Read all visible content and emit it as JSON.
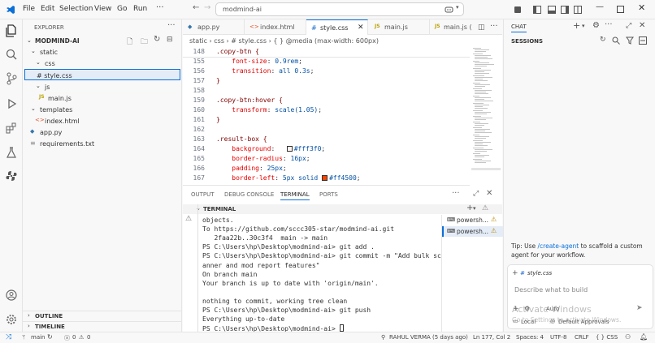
{
  "titlebar": {
    "menus": [
      "File",
      "Edit",
      "Selection",
      "View",
      "Go",
      "Run"
    ],
    "search_text": "modmind-ai",
    "accent": "#0a6fd8"
  },
  "explorer": {
    "header": "EXPLORER",
    "project": "MODMIND-AI",
    "items": [
      {
        "label": "static",
        "icon": "chevron-down-icon"
      },
      {
        "label": "css",
        "icon": "chevron-down-icon"
      },
      {
        "label": "# style.css",
        "icon": "css-file-icon"
      },
      {
        "label": "js",
        "icon": "chevron-down-icon"
      },
      {
        "label": "main.js",
        "icon": "js-file-icon"
      },
      {
        "label": "templates",
        "icon": "chevron-down-icon"
      },
      {
        "label": "index.html",
        "icon": "html-file-icon"
      },
      {
        "label": "app.py",
        "icon": "python-file-icon"
      },
      {
        "label": "requirements.txt",
        "icon": "text-file-icon"
      }
    ],
    "outline": "OUTLINE",
    "timeline": "TIMELINE"
  },
  "tabs": [
    {
      "label": "app.py",
      "icon": "python-file-icon"
    },
    {
      "label": "index.html",
      "icon": "html-file-icon"
    },
    {
      "label": "style.css",
      "icon": "css-file-icon"
    },
    {
      "label": "main.js",
      "icon": "js-file-icon"
    },
    {
      "label": "main.js (",
      "icon": "js-file-icon"
    }
  ],
  "breadcrumb": [
    "static",
    "css",
    "# style.css",
    "{ } @media (max-width: 600px)"
  ],
  "editor": {
    "lines": [
      {
        "n": "148",
        "t": ".copy-btn {"
      },
      {
        "n": "155",
        "t": "    font-size: 0.9rem;"
      },
      {
        "n": "156",
        "t": "    transition: all 0.3s;"
      },
      {
        "n": "157",
        "t": "}"
      },
      {
        "n": "158",
        "t": ""
      },
      {
        "n": "159",
        "t": ".copy-btn:hover {"
      },
      {
        "n": "160",
        "t": "    transform: scale(1.05);"
      },
      {
        "n": "161",
        "t": "}"
      },
      {
        "n": "162",
        "t": ""
      },
      {
        "n": "163",
        "t": ".result-box {"
      },
      {
        "n": "164",
        "t": "    background:   #fff3f0;"
      },
      {
        "n": "165",
        "t": "    border-radius: 16px;"
      },
      {
        "n": "166",
        "t": "    padding: 25px;"
      },
      {
        "n": "167",
        "t": "    border-left: 5px solid   #ff4500;"
      }
    ],
    "swatches": [
      "#fff3f0",
      "#ff4500"
    ]
  },
  "panel": {
    "tabs": [
      "OUTPUT",
      "DEBUG CONSOLE",
      "TERMINAL",
      "PORTS"
    ],
    "terminal_title": "TERMINAL",
    "lines": [
      "objects.",
      "To https://github.com/sccc305-star/modmind-ai.git",
      "   2faa22b..30c3f4  main -> main",
      "PS C:\\Users\\hp\\Desktop\\modmind-ai> git add .",
      "PS C:\\Users\\hp\\Desktop\\modmind-ai> git commit -m \"Add bulk sc",
      "anner and mod report features\"",
      "On branch main",
      "Your branch is up to date with 'origin/main'.",
      "",
      "nothing to commit, working tree clean",
      "PS C:\\Users\\hp\\Desktop\\modmind-ai> git push",
      "Everything up-to-date",
      "PS C:\\Users\\hp\\Desktop\\modmind-ai> "
    ],
    "sessions": [
      "powersh...",
      "powersh..."
    ]
  },
  "chat": {
    "title": "CHAT",
    "sessions_header": "SESSIONS",
    "tip_prefix": "Tip: Use ",
    "tip_link": "/create-agent",
    "tip_suffix": " to scaffold a custom agent for your workflow.",
    "context_file": "style.css",
    "placeholder": "Describe what to build",
    "mode": "Auto",
    "local": "Local",
    "approvals": "Default Approvals",
    "watermark_title": "Activate Windows",
    "watermark_sub": "Go to Settings to activate Windows."
  },
  "status": {
    "branch": "main",
    "errors": "0",
    "warnings": "0",
    "blame": "RAHUL VERMA (5 days ago)",
    "position": "Ln 177, Col 2",
    "spaces": "Spaces: 4",
    "encoding": "UTF-8",
    "eol": "CRLF",
    "language": "{ } CSS"
  }
}
